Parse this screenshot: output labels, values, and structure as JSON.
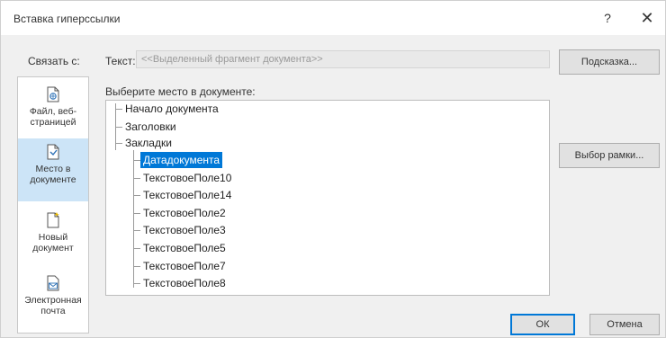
{
  "dialog": {
    "title": "Вставка гиперссылки",
    "help_glyph": "?",
    "close_glyph": "✕"
  },
  "link_to": {
    "label": "Связать с:",
    "items": [
      {
        "label": "Файл, веб-страницей",
        "icon": "file-web-icon",
        "selected": false
      },
      {
        "label": "Место в документе",
        "icon": "place-in-document-icon",
        "selected": true
      },
      {
        "label": "Новый документ",
        "icon": "new-document-icon",
        "selected": false
      },
      {
        "label": "Электронная почта",
        "icon": "email-icon",
        "selected": false
      }
    ]
  },
  "text_field": {
    "label": "Текст:",
    "value": "<<Выделенный фрагмент документа>>"
  },
  "buttons": {
    "tooltip": "Подсказка...",
    "target_frame": "Выбор рамки...",
    "ok": "ОК",
    "cancel": "Отмена"
  },
  "place": {
    "label": "Выберите место в документе:",
    "tree": {
      "items": [
        {
          "label": "Начало документа",
          "level": 0
        },
        {
          "label": "Заголовки",
          "level": 0
        },
        {
          "label": "Закладки",
          "level": 0
        },
        {
          "label": "Датадокумента",
          "level": 1,
          "selected": true
        },
        {
          "label": "ТекстовоеПоле10",
          "level": 1
        },
        {
          "label": "ТекстовоеПоле14",
          "level": 1
        },
        {
          "label": "ТекстовоеПоле2",
          "level": 1
        },
        {
          "label": "ТекстовоеПоле3",
          "level": 1
        },
        {
          "label": "ТекстовоеПоле5",
          "level": 1
        },
        {
          "label": "ТекстовоеПоле7",
          "level": 1
        },
        {
          "label": "ТекстовоеПоле8",
          "level": 1
        }
      ]
    }
  },
  "colors": {
    "selection": "#0078d7",
    "sidebar_selection": "#cce4f7"
  }
}
